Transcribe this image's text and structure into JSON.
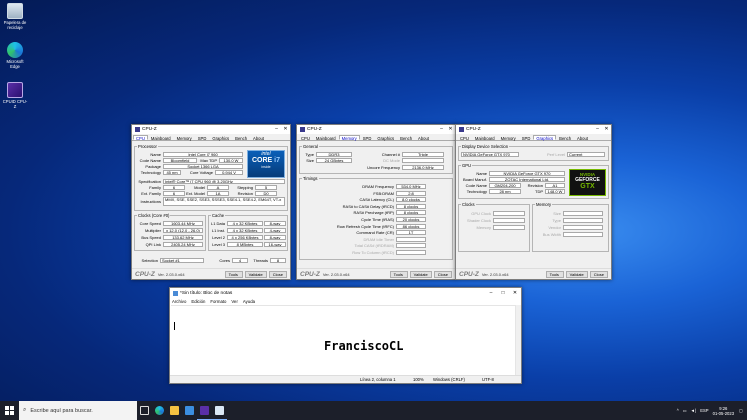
{
  "desktop": {
    "icons": [
      {
        "label": "Papelera de reciclaje",
        "icon": "recycle-bin-icon"
      },
      {
        "label": "Microsoft Edge",
        "icon": "edge-icon"
      },
      {
        "label": "CPUID CPU-Z",
        "icon": "cpuz-icon"
      }
    ]
  },
  "cpuz_common": {
    "title": "CPU-Z",
    "tabs": [
      "CPU",
      "Mainboard",
      "Memory",
      "SPD",
      "Graphics",
      "Bench",
      "About"
    ],
    "logo": "CPU-Z",
    "version": "Ver. 2.03.0.x64",
    "tools": "Tools",
    "validate": "Validate",
    "close": "Close"
  },
  "cpu_window": {
    "processor_group": "Processor",
    "name_label": "Name",
    "name": "Intel Core i7 960",
    "codename_label": "Code Name",
    "codename": "Bloomfield",
    "maxtdp_label": "Max TDP",
    "maxtdp": "130.0 W",
    "package_label": "Package",
    "package": "Socket 1366 LGA",
    "technology_label": "Technology",
    "technology": "45 nm",
    "corevoltage_label": "Core Voltage",
    "corevoltage": "0.944 V",
    "spec_label": "Specification",
    "spec": "Intel® Core™ i7 CPU         960  @ 3.20GHz",
    "family_label": "Family",
    "family": "6",
    "model_label": "Model",
    "model": "A",
    "stepping_label": "Stepping",
    "stepping": "5",
    "extfamily_label": "Ext. Family",
    "extfamily": "6",
    "extmodel_label": "Ext. Model",
    "extmodel": "1A",
    "revision_label": "Revision",
    "revision": "D0",
    "instructions_label": "Instructions",
    "instructions": "MMX, SSE, SSE2, SSE3, SSSE3, SSE4.1, SSE4.2, EM64T, VT-x",
    "clocks_group": "Clocks (Core #0)",
    "corespeed_label": "Core Speed",
    "corespeed": "1603.44 MHz",
    "multiplier_label": "Multiplier",
    "multiplier": "x 12.0 (12.0 - 26.0)",
    "busspeed_label": "Bus Speed",
    "busspeed": "133.62 MHz",
    "qpilink_label": "QPI Link",
    "qpilink": "2405.24 MHz",
    "cache_group": "Cache",
    "l1d_label": "L1 Data",
    "l1d": "4 x 32 KBytes",
    "l1d_way": "8-way",
    "l1i_label": "L1 Inst.",
    "l1i": "4 x 32 KBytes",
    "l1i_way": "4-way",
    "l2_label": "Level 2",
    "l2": "4 x 256 KBytes",
    "l2_way": "8-way",
    "l3_label": "Level 3",
    "l3": "8 MBytes",
    "l3_way": "16-way",
    "selection_label": "Selection",
    "selection": "Socket #1",
    "cores_label": "Cores",
    "cores": "4",
    "threads_label": "Threads",
    "threads": "8",
    "badge_brand": "intel",
    "badge_core": "CORE",
    "badge_i7": "i7",
    "badge_inside": "inside"
  },
  "memory_window": {
    "general_group": "General",
    "type_label": "Type",
    "type": "DDR3",
    "channel_label": "Channel #",
    "channel": "Triple",
    "size_label": "Size",
    "size": "24 GBytes",
    "dcmode_label": "DC Mode",
    "uncore_label": "Uncore Frequency",
    "uncore": "2136.0 MHz",
    "timings_group": "Timings",
    "timings": [
      {
        "label": "DRAM Frequency",
        "value": "534.0 MHz",
        "enabled": true
      },
      {
        "label": "FSB:DRAM",
        "value": "2:8",
        "enabled": true
      },
      {
        "label": "CAS# Latency (CL)",
        "value": "8.0 clocks",
        "enabled": true
      },
      {
        "label": "RAS# to CAS# Delay (tRCD)",
        "value": "8 clocks",
        "enabled": true
      },
      {
        "label": "RAS# Precharge (tRP)",
        "value": "8 clocks",
        "enabled": true
      },
      {
        "label": "Cycle Time (tRAS)",
        "value": "20 clocks",
        "enabled": true
      },
      {
        "label": "Row Refresh Cycle Time (tRFC)",
        "value": "86 clocks",
        "enabled": true
      },
      {
        "label": "Command Rate (CR)",
        "value": "1T",
        "enabled": true
      },
      {
        "label": "DRAM Idle Timer",
        "value": "",
        "enabled": false
      },
      {
        "label": "Total CAS# (tRDRAM)",
        "value": "",
        "enabled": false
      },
      {
        "label": "Row To Column (tRCD)",
        "value": "",
        "enabled": false
      }
    ]
  },
  "graphics_window": {
    "display_group": "Display Device Selection",
    "device": "NVIDIA GeForce GTX 970",
    "perf_label": "Perf Level",
    "perf": "Current",
    "gpu_group": "GPU",
    "name_label": "Name",
    "name": "NVIDIA GeForce GTX 970",
    "board_label": "Board Manuf.",
    "board": "ZOTAC International Ltd.",
    "code_label": "Code Name",
    "code": "GM204-200",
    "revision_label": "Revision",
    "revision": "A1",
    "tech_label": "Technology",
    "tech": "28 nm",
    "tdp_label": "TDP",
    "tdp": "148.0 W",
    "clocks_group": "Clocks",
    "gpuclock_label": "GPU Clock",
    "shaderclock_label": "Shader Clock",
    "memory_label": "Memory",
    "memory_group": "Memory",
    "size_label": "Size",
    "type_label": "Type",
    "vendor_label": "Vendor",
    "buswidth_label": "Bus Width",
    "badge_brand": "NVIDIA",
    "badge_line": "GEFORCE",
    "badge_gtx": "GTX"
  },
  "notepad": {
    "title": "*Sin título: Bloc de notas",
    "menu": [
      "Archivo",
      "Edición",
      "Formato",
      "Ver",
      "Ayuda"
    ],
    "content": "FranciscoCL",
    "status_pos": "Línea 2, columna 1",
    "status_zoom": "100%",
    "status_eol": "Windows (CRLF)",
    "status_enc": "UTF-8"
  },
  "taskbar": {
    "search_placeholder": "Escribe aquí para buscar.",
    "lang": "ESP",
    "time": "9:26",
    "date": "01-05-2023"
  }
}
